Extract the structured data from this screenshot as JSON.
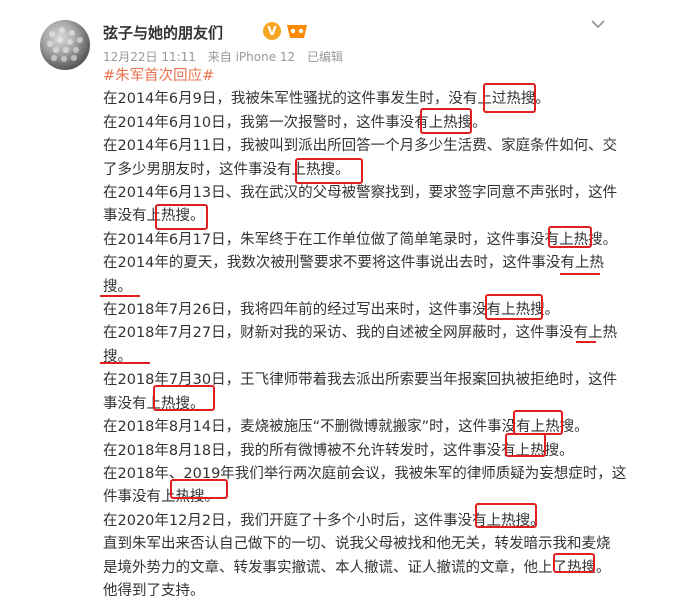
{
  "post": {
    "author": "弦子与她的朋友们",
    "verified_badge": "V",
    "date": "12月22日 11:11",
    "source": "来自 iPhone 12",
    "edited": "已编辑",
    "hashtag": "#朱军首次回应#",
    "lines": [
      "在2014年6月9日，我被朱军性骚扰的这件事发生时，没有上过热搜。",
      "在2014年6月10日，我第一次报警时，这件事没有上热搜。",
      "在2014年6月11日，我被叫到派出所回答一个月多少生活费、家庭条件如何、交",
      "了多少男朋友时，这件事没有上热搜。",
      "在2014年6月13日、我在武汉的父母被警察找到，要求签字同意不声张时，这件",
      "事没有上热搜。",
      "在2014年6月17日，朱军终于在工作单位做了简单笔录时，这件事没有上热搜。",
      "在2014年的夏天，我数次被刑警要求不要将这件事说出去时，这件事没有上热",
      "搜。",
      "在2018年7月26日，我将四年前的经过写出来时，这件事没有上热搜。",
      "在2018年7月27日，财新对我的采访、我的自述被全网屏蔽时，这件事没有上热",
      "搜。",
      "在2018年7月30日，王飞律师带着我去派出所索要当年报案回执被拒绝时，这件",
      "事没有上热搜。",
      "在2018年8月14日，麦烧被施压“不删微博就搬家”时，这件事没有上热搜。",
      "在2018年8月18日，我的所有微博被不允许转发时，这件事没有上热搜。",
      "在2018年、2019年我们举行两次庭前会议，我被朱军的律师质疑为妄想症时，这",
      "件事没有上热搜。",
      "在2020年12月2日，我们开庭了十多个小时后，这件事没有上热搜。",
      "直到朱军出来否认自己做下的一切、说我父母被找和他无关，转发暗示我和麦烧",
      "是境外势力的文章、转发事实撤谎、本人撤谎、证人撤谎的文章，他上了热搜。",
      "他得到了支持。"
    ]
  },
  "colors": {
    "hashtag": "#eb7350",
    "annotation": "#e02020",
    "meta": "#999999",
    "vip": "#f6a623"
  },
  "icons": {
    "more": "chevron-down-icon",
    "verified": "verified-v-icon",
    "level": "level-badge-icon"
  }
}
